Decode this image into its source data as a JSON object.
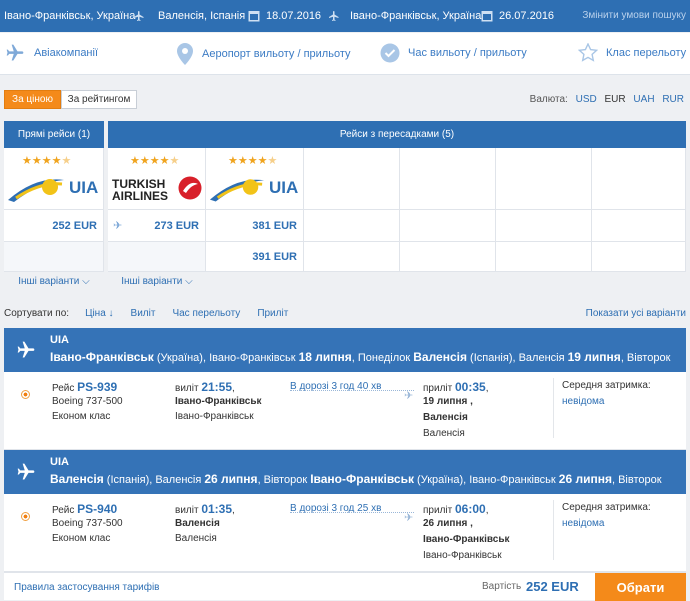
{
  "search": {
    "origin": "Івано-Франківськ, Україна",
    "destination": "Валенсія, Іспанія",
    "date_out": "18.07.2016",
    "return_origin": "Івано-Франківськ, Україна",
    "date_back": "26.07.2016",
    "modify": "Змінити умови пошуку"
  },
  "filters": {
    "airlines": "Авіакомпанії",
    "airport": "Аеропорт вильоту / прильоту",
    "time": "Час вильоту / прильоту",
    "class": "Клас перельоту"
  },
  "sort_toggle": {
    "by_price": "За ціною",
    "by_rating": "За рейтингом"
  },
  "currency": {
    "label": "Валюта:",
    "options": [
      "USD",
      "EUR",
      "UAH",
      "RUR"
    ],
    "active": "EUR"
  },
  "grid": {
    "direct_title": "Прямі рейси (1)",
    "transfer_title": "Рейси з пересадками (5)",
    "direct_price": "252 EUR",
    "turkish_price": "273 EUR",
    "uia2_price_1": "381 EUR",
    "uia2_price_2": "391 EUR",
    "more": "Інші варіанти",
    "logos": {
      "uia": "UIA",
      "turkish_1": "TURKISH",
      "turkish_2": "AIRLINES"
    }
  },
  "sort": {
    "label": "Сортувати по:",
    "price": "Ціна ↓",
    "departure": "Виліт",
    "duration": "Час перельоту",
    "arrival": "Приліт",
    "show_all": "Показати усі варіанти"
  },
  "legs": [
    {
      "airline": "UIA",
      "from_city": "Івано-Франківськ",
      "from_rest": " (Україна), Івано-Франківськ ",
      "from_date": "18 липня",
      "from_day": ", Понеділок ",
      "to_city": "Валенсія",
      "to_rest": " (Іспанія), Валенсія ",
      "to_date": "19 липня",
      "to_day": ", Вівторок",
      "flight_label": "Рейс",
      "flight_no": "PS-939",
      "aircraft": "Boeing 737-500",
      "cabin": "Економ клас",
      "dep_label": "виліт",
      "dep_time": "21:55",
      "dep_city": "Івано-Франківськ",
      "dep_airport": "Івано-Франківськ",
      "en_route": "В дорозі 3 год 40 хв",
      "arr_label": "приліт",
      "arr_time": "00:35",
      "arr_date": "19 липня",
      "arr_city": "Валенсія",
      "arr_airport": "Валенсія",
      "delay_label": "Середня затримка:",
      "delay_value": "невідома"
    },
    {
      "airline": "UIA",
      "from_city": "Валенсія",
      "from_rest": " (Іспанія), Валенсія ",
      "from_date": "26 липня",
      "from_day": ", Вівторок ",
      "to_city": "Івано-Франківськ",
      "to_rest": " (Україна), Івано-Франківськ ",
      "to_date": "26 липня",
      "to_day": ", Вівторок",
      "flight_label": "Рейс",
      "flight_no": "PS-940",
      "aircraft": "Boeing 737-500",
      "cabin": "Економ клас",
      "dep_label": "виліт",
      "dep_time": "01:35",
      "dep_city": "Валенсія",
      "dep_airport": "Валенсія",
      "en_route": "В дорозі 3 год 25 хв",
      "arr_label": "приліт",
      "arr_time": "06:00",
      "arr_date": "26 липня",
      "arr_city": "Івано-Франківськ",
      "arr_airport": "Івано-Франківськ",
      "delay_label": "Середня затримка:",
      "delay_value": "невідома"
    }
  ],
  "footer": {
    "rules": "Правила застосування тарифів",
    "cost_label": "Вартість",
    "cost": "252 EUR",
    "select": "Обрати"
  },
  "colors": {
    "brand_blue": "#2e6fb3",
    "accent_orange": "#f48a1a",
    "star": "#f0a41e"
  }
}
